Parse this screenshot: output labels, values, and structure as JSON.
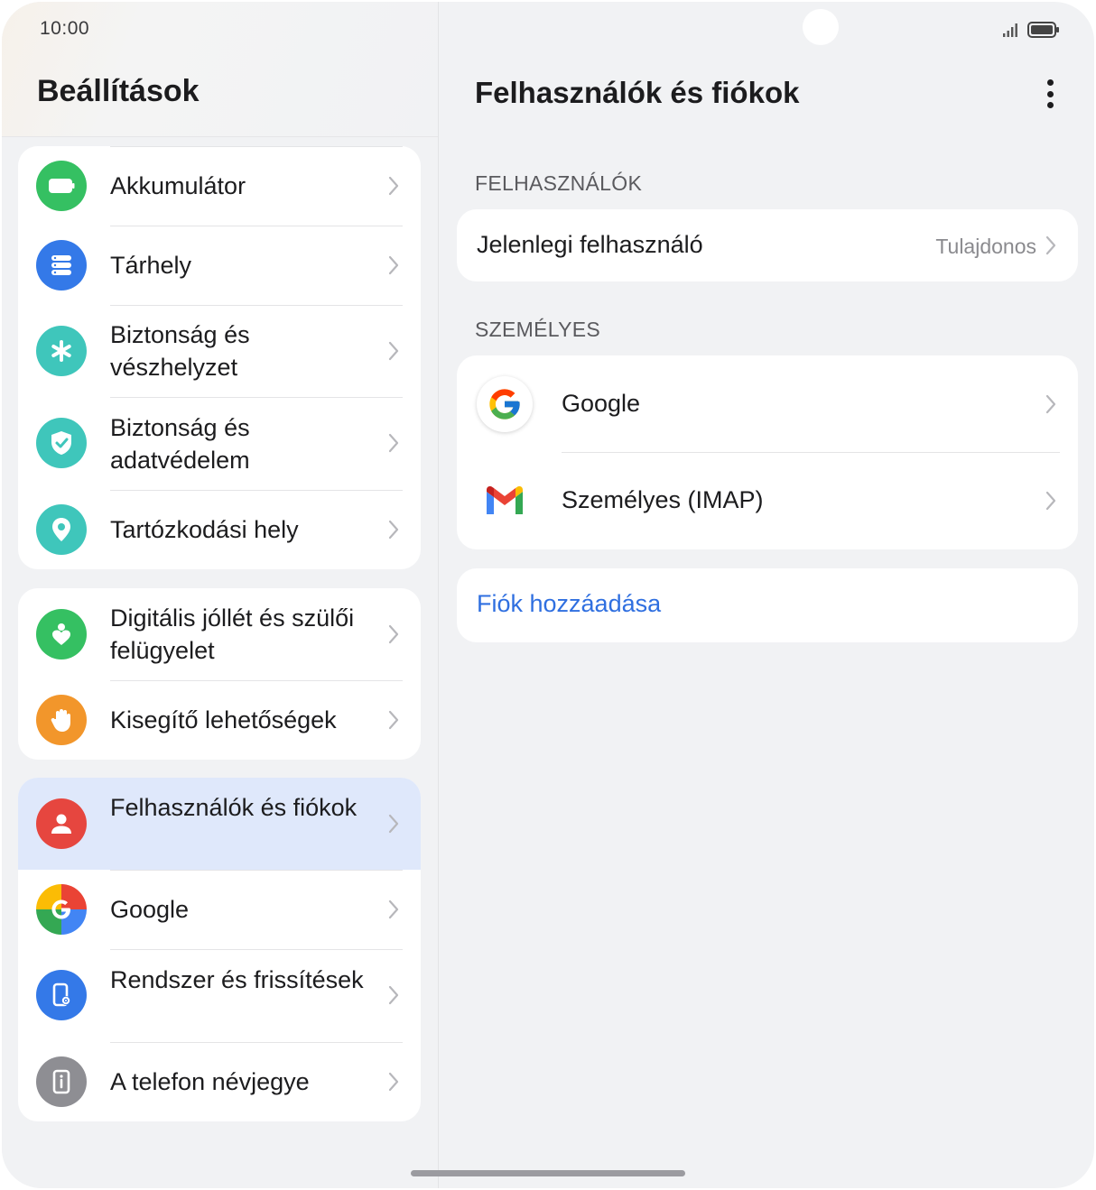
{
  "status_bar": {
    "time": "10:00"
  },
  "left_pane": {
    "title": "Beállítások",
    "groups": [
      {
        "items": [
          {
            "label": "Akkumulátor",
            "icon": "battery-icon",
            "color": "#35c062"
          },
          {
            "label": "Tárhely",
            "icon": "storage-icon",
            "color": "#3479e8"
          },
          {
            "label": "Biztonság és vészhelyzet",
            "icon": "asterisk-icon",
            "color": "#3fc6bb"
          },
          {
            "label": "Biztonság és adatvédelem",
            "icon": "shield-icon",
            "color": "#3fc6bb"
          },
          {
            "label": "Tartózkodási hely",
            "icon": "location-icon",
            "color": "#3fc6bb"
          }
        ]
      },
      {
        "items": [
          {
            "label": "Digitális jóllét és szülői felügyelet",
            "icon": "wellbeing-icon",
            "color": "#35c062"
          },
          {
            "label": "Kisegítő lehetőségek",
            "icon": "hand-icon",
            "color": "#f2962b"
          }
        ]
      },
      {
        "items": [
          {
            "label": "Felhasználók és fiókok",
            "icon": "user-icon",
            "color": "#e6463f",
            "selected": true
          },
          {
            "label": "Google",
            "icon": "google-icon"
          },
          {
            "label": "Rendszer és frissítések",
            "icon": "system-update-icon",
            "color": "#3479e8"
          },
          {
            "label": "A telefon névjegye",
            "icon": "phone-info-icon",
            "color": "#8e8e93"
          }
        ]
      }
    ]
  },
  "right_pane": {
    "title": "Felhasználók és fiókok",
    "users_section": {
      "header": "FELHASZNÁLÓK",
      "current_user_label": "Jelenlegi felhasználó",
      "current_user_value": "Tulajdonos"
    },
    "personal_section": {
      "header": "SZEMÉLYES",
      "accounts": [
        {
          "label": "Google",
          "icon": "google-logo-icon"
        },
        {
          "label": "Személyes (IMAP)",
          "icon": "gmail-icon"
        }
      ]
    },
    "add_account_label": "Fiók hozzáadása"
  },
  "colors": {
    "accent": "#2f6fe0",
    "selected_row": "#dfe8fb",
    "background": "#f1f2f4"
  }
}
